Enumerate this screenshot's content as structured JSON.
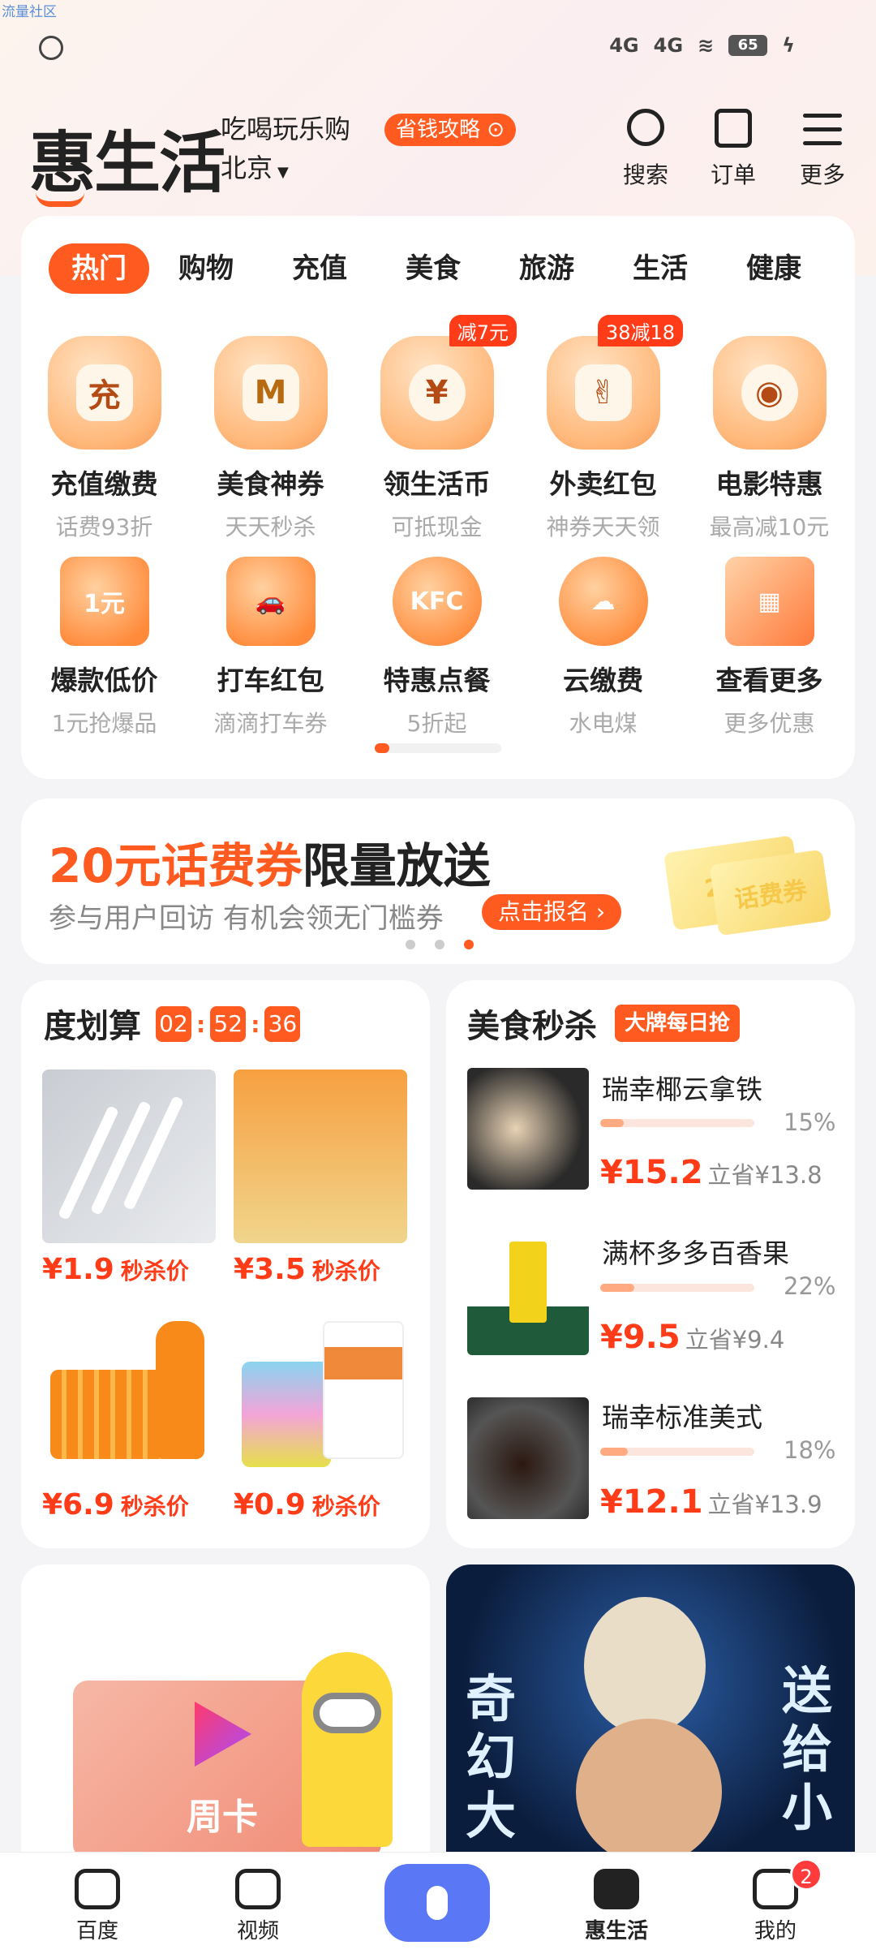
{
  "watermark": "流量社区",
  "status_bar": {
    "net1": "4G",
    "net2": "4G",
    "battery": "65"
  },
  "header": {
    "logo": "惠生活",
    "slogan": "吃喝玩乐购",
    "city": "北京",
    "strategy_label": "省钱攻略",
    "search_label": "搜索",
    "orders_label": "订单",
    "more_label": "更多"
  },
  "tabs": [
    "热门",
    "购物",
    "充值",
    "美食",
    "旅游",
    "生活",
    "健康"
  ],
  "services_row1": [
    {
      "icon_text": "充",
      "title": "充值缴费",
      "sub": "话费93折",
      "tag": ""
    },
    {
      "icon_text": "M",
      "title": "美食神券",
      "sub": "天天秒杀",
      "tag": ""
    },
    {
      "icon_text": "¥",
      "title": "领生活币",
      "sub": "可抵现金",
      "tag": "减7元"
    },
    {
      "icon_text": "✌",
      "title": "外卖红包",
      "sub": "神券天天领",
      "tag": "38减18"
    },
    {
      "icon_text": "◉",
      "title": "电影特惠",
      "sub": "最高减10元",
      "tag": ""
    }
  ],
  "services_row2": [
    {
      "icon_text": "1元",
      "title": "爆款低价",
      "sub": "1元抢爆品"
    },
    {
      "icon_text": "🚗",
      "title": "打车红包",
      "sub": "滴滴打车券"
    },
    {
      "icon_text": "KFC",
      "title": "特惠点餐",
      "sub": "5折起"
    },
    {
      "icon_text": "☁",
      "title": "云缴费",
      "sub": "水电煤"
    },
    {
      "icon_text": "▦",
      "title": "查看更多",
      "sub": "更多优惠"
    }
  ],
  "banner": {
    "title_orange": "20元话费券",
    "title_rest": "限量放送",
    "subtitle": "参与用户回访 有机会领无门槛券",
    "button": "点击报名",
    "ticket1": "20元",
    "ticket2": "话费券"
  },
  "flash_sale": {
    "title": "度划算",
    "timer": [
      "02",
      "52",
      "36"
    ],
    "items": [
      {
        "price": "¥1.9",
        "suffix": "秒杀价"
      },
      {
        "price": "¥3.5",
        "suffix": "秒杀价"
      },
      {
        "price": "¥6.9",
        "suffix": "秒杀价"
      },
      {
        "price": "¥0.9",
        "suffix": "秒杀价"
      }
    ]
  },
  "food_sale": {
    "title": "美食秒杀",
    "badge": "大牌每日抢",
    "items": [
      {
        "name": "瑞幸椰云拿铁",
        "pct": "15%",
        "progress": 0.15,
        "price": "¥15.2",
        "save": "立省¥13.8"
      },
      {
        "name": "满杯多多百香果",
        "pct": "22%",
        "progress": 0.22,
        "price": "¥9.5",
        "save": "立省¥9.4"
      },
      {
        "name": "瑞幸标准美式",
        "pct": "18%",
        "progress": 0.18,
        "price": "¥12.1",
        "save": "立省¥13.9"
      }
    ]
  },
  "week_card": {
    "label": "周卡"
  },
  "movie": {
    "left_text": "奇幻大",
    "right_text": "送给小"
  },
  "bottom_nav": {
    "baidu": "百度",
    "video": "视频",
    "huishenghuo": "惠生活",
    "mine": "我的",
    "badge": "2"
  }
}
